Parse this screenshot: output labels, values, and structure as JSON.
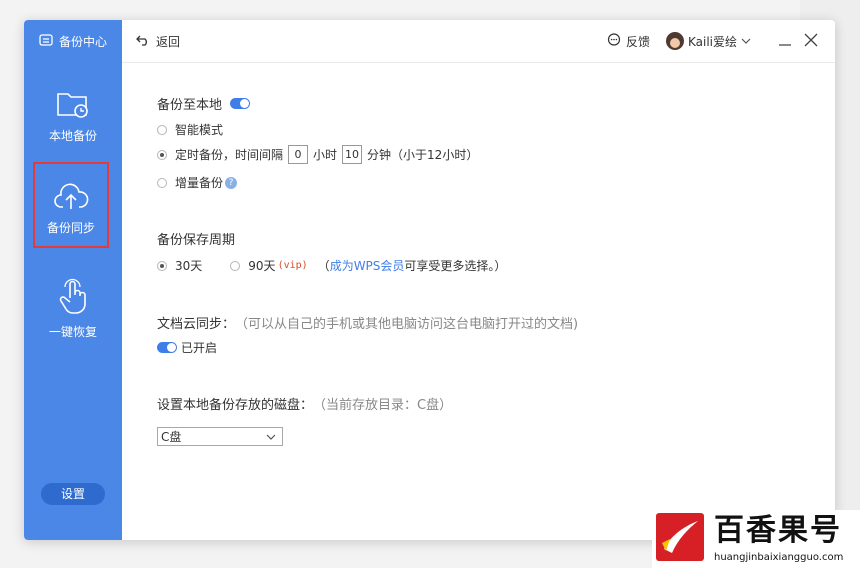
{
  "sidebar": {
    "brand": "备份中心",
    "items": [
      {
        "label": "本地备份",
        "icon": "folder-clock-icon"
      },
      {
        "label": "备份同步",
        "icon": "cloud-upload-icon",
        "selected": true
      },
      {
        "label": "一键恢复",
        "icon": "hand-pointer-icon"
      }
    ],
    "settings_label": "设置"
  },
  "topbar": {
    "back_label": "返回",
    "feedback_label": "反馈",
    "username": "Kaili爱绘"
  },
  "backup_local": {
    "title": "备份至本地",
    "enabled": true,
    "mode_smart": "智能模式",
    "mode_timed": "定时备份，时间间隔",
    "hours_value": "0",
    "hours_unit": "小时",
    "minutes_value": "10",
    "minutes_unit": "分钟",
    "limit_note": "（小于12小时）",
    "mode_incremental": "增量备份",
    "help_glyph": "?",
    "selected_mode": "timed"
  },
  "retention": {
    "title": "备份保存周期",
    "option_30": "30天",
    "option_90": "90天",
    "vip_tag": "(vip)",
    "paren_open": "（",
    "member_link": "成为WPS会员",
    "member_text": " 可享受更多选择。）",
    "selected": "30"
  },
  "cloud_sync": {
    "title": "文档云同步：",
    "hint": "（可以从自己的手机或其他电脑访问这台电脑打开过的文档)",
    "status": "已开启",
    "enabled": true
  },
  "disk": {
    "title": "设置本地备份存放的磁盘：",
    "hint": "（当前存放目录：C盘）",
    "selected": "C盘"
  },
  "watermark": {
    "title": "百香果号",
    "url": "huangjinbaixiangguo.com"
  },
  "colors": {
    "sidebar_bg": "#4b87e7",
    "accent": "#3f7ee8",
    "highlight_border": "#e33a3a",
    "vip": "#d9482b"
  }
}
